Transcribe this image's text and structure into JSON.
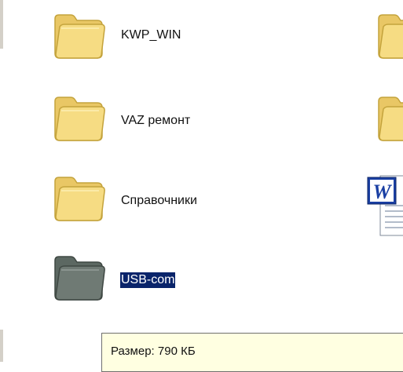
{
  "file_list": {
    "items": [
      {
        "name": "KWP_WIN",
        "type": "folder-icon",
        "selected": false
      },
      {
        "name": "VAZ ремонт",
        "type": "folder-icon",
        "selected": false
      },
      {
        "name": "Справочники",
        "type": "folder-icon",
        "selected": false
      },
      {
        "name": "USB-com",
        "type": "folder-icon",
        "selected": true
      }
    ],
    "partial_column_icons": [
      "folder-icon",
      "folder-icon",
      "word-document-icon"
    ]
  },
  "tooltip": {
    "text": "Размер: 790 КБ"
  },
  "colors": {
    "folder_fill": "#f6dc83",
    "folder_stroke": "#c4a33c",
    "folder_selected_fill": "#6f7a74",
    "selection_highlight": "#0a246a",
    "tooltip_background": "#ffffe1",
    "word_blue": "#1a3fa3"
  }
}
